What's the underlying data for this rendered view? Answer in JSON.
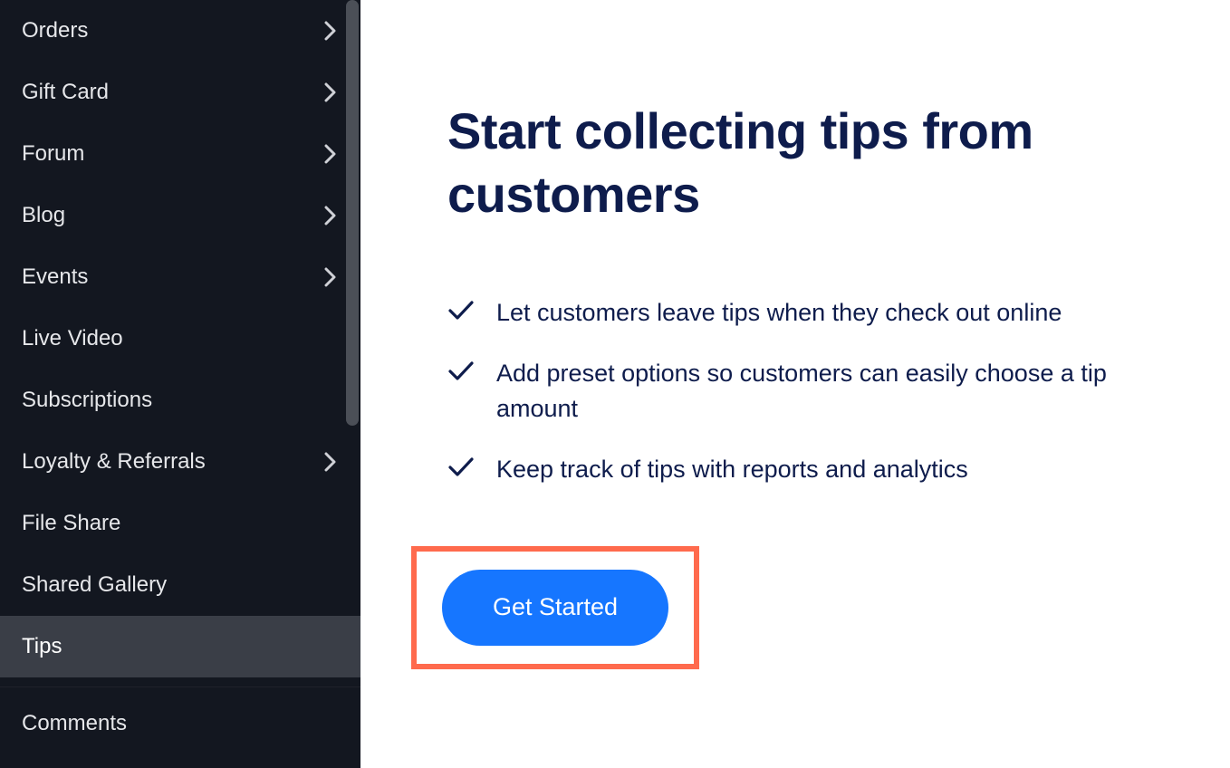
{
  "sidebar": {
    "items": [
      {
        "label": "Orders",
        "expandable": true,
        "active": false
      },
      {
        "label": "Gift Card",
        "expandable": true,
        "active": false
      },
      {
        "label": "Forum",
        "expandable": true,
        "active": false
      },
      {
        "label": "Blog",
        "expandable": true,
        "active": false
      },
      {
        "label": "Events",
        "expandable": true,
        "active": false
      },
      {
        "label": "Live Video",
        "expandable": false,
        "active": false
      },
      {
        "label": "Subscriptions",
        "expandable": false,
        "active": false
      },
      {
        "label": "Loyalty & Referrals",
        "expandable": true,
        "active": false
      },
      {
        "label": "File Share",
        "expandable": false,
        "active": false
      },
      {
        "label": "Shared Gallery",
        "expandable": false,
        "active": false
      },
      {
        "label": "Tips",
        "expandable": false,
        "active": true
      }
    ],
    "secondary": [
      {
        "label": "Comments",
        "expandable": false,
        "active": false
      }
    ]
  },
  "main": {
    "headline": "Start collecting tips from customers",
    "benefits": [
      "Let customers leave tips when they check out online",
      "Add preset options so customers can easily choose a tip amount",
      "Keep track of tips with reports and analytics"
    ],
    "cta_label": "Get Started"
  }
}
